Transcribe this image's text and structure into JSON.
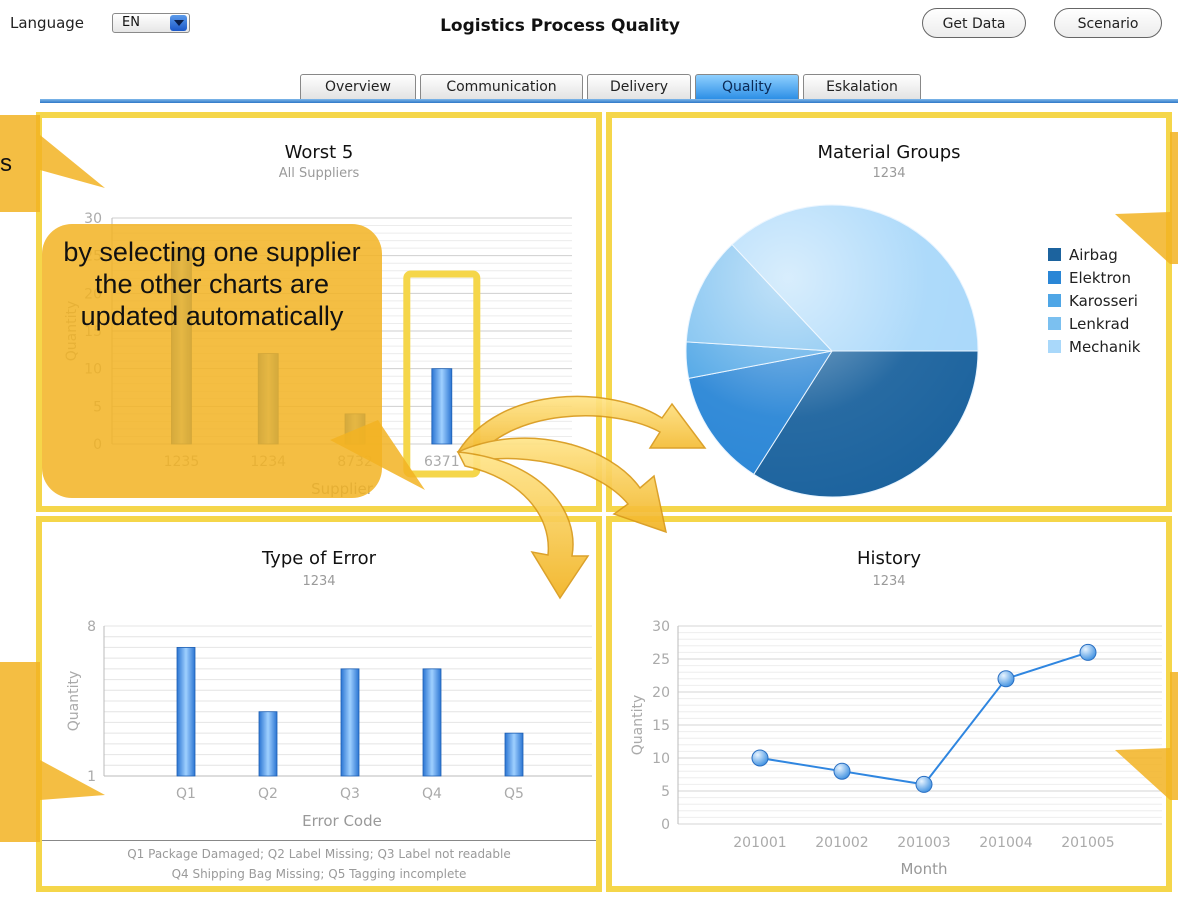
{
  "app": {
    "title": "Logistics Process Quality",
    "language_label": "Language",
    "language_value": "EN",
    "get_data_label": "Get Data",
    "scenario_label": "Scenario"
  },
  "tabs": [
    {
      "label": "Overview",
      "active": false
    },
    {
      "label": "Communication",
      "active": false
    },
    {
      "label": "Delivery",
      "active": false
    },
    {
      "label": "Quality",
      "active": true
    },
    {
      "label": "Eskalation",
      "active": false
    }
  ],
  "colors": {
    "highlight": "#f5d64a",
    "callout": "#f2b322",
    "bar_blue": "#3a8ee6",
    "line_blue": "#2f86e0",
    "tab_active": "#2d8fe6"
  },
  "annotation": {
    "main_text": "by selecting one supplier the other charts are updated automatically",
    "left_fragment": "s"
  },
  "worst5": {
    "title": "Worst 5",
    "subtitle": "All Suppliers"
  },
  "material": {
    "title": "Material Groups",
    "subtitle": "1234"
  },
  "errors": {
    "title": "Type of Error",
    "subtitle": "1234",
    "footnote_line1": "Q1 Package Damaged; Q2 Label Missing; Q3 Label not readable",
    "footnote_line2": "Q4 Shipping Bag Missing; Q5 Tagging incomplete"
  },
  "history": {
    "title": "History",
    "subtitle": "1234"
  },
  "chart_data": [
    {
      "id": "worst5",
      "type": "bar",
      "title": "Worst 5",
      "subtitle": "All Suppliers",
      "xlabel": "Supplier",
      "ylabel": "Quantity",
      "categories": [
        "1235",
        "1234",
        "8732",
        "6371"
      ],
      "values": [
        26,
        12,
        4,
        10
      ],
      "ylim": [
        0,
        30
      ],
      "yticks": [
        0,
        5,
        10,
        15,
        20,
        25,
        30
      ],
      "selected": "6371",
      "grid": true
    },
    {
      "id": "material",
      "type": "pie",
      "title": "Material Groups",
      "subtitle": "1234",
      "labels": [
        "Airbag",
        "Elektron",
        "Karosseri",
        "Lenkrad",
        "Mechanik"
      ],
      "values": [
        34,
        13,
        4,
        12,
        37
      ],
      "colors": [
        "#1c639e",
        "#2a86d6",
        "#4fa6e6",
        "#7bc0f0",
        "#a9d8fa"
      ],
      "legend": "right"
    },
    {
      "id": "errors",
      "type": "bar",
      "title": "Type of Error",
      "subtitle": "1234",
      "xlabel": "Error Code",
      "ylabel": "Quantity",
      "categories": [
        "Q1",
        "Q2",
        "Q3",
        "Q4",
        "Q5"
      ],
      "values": [
        7,
        4,
        6,
        6,
        3
      ],
      "ylim": [
        1,
        8
      ],
      "yticks": [
        1,
        8
      ],
      "grid": true
    },
    {
      "id": "history",
      "type": "line",
      "title": "History",
      "subtitle": "1234",
      "xlabel": "Month",
      "ylabel": "Quantity",
      "categories": [
        "201001",
        "201002",
        "201003",
        "201004",
        "201005"
      ],
      "values": [
        10,
        8,
        6,
        22,
        26
      ],
      "ylim": [
        0,
        30
      ],
      "yticks": [
        0,
        5,
        10,
        15,
        20,
        25,
        30
      ],
      "grid": true
    }
  ]
}
